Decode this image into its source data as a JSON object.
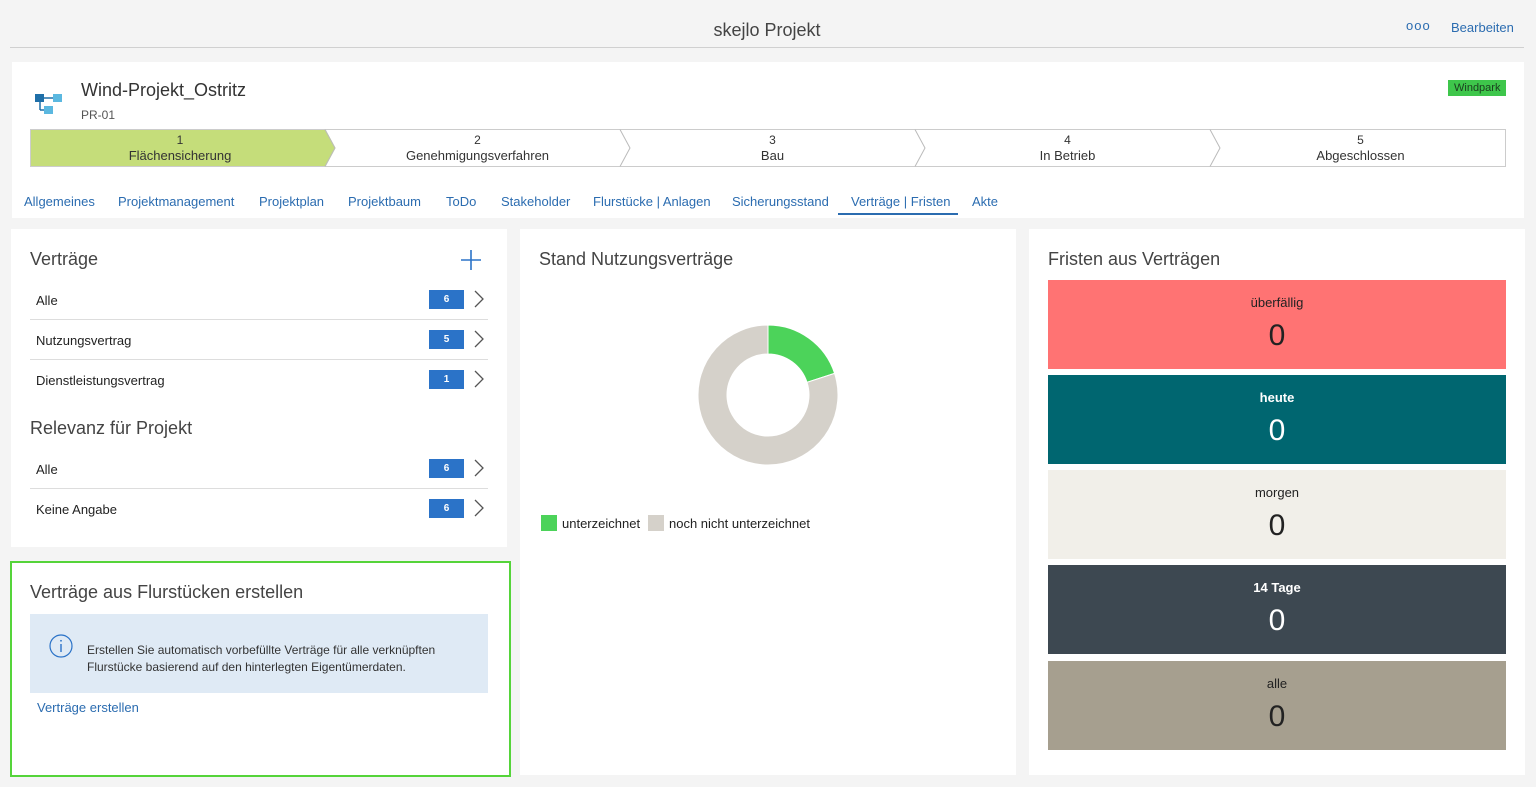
{
  "header": {
    "title": "skejlo Projekt",
    "more_label": "ooo",
    "edit_label": "Bearbeiten"
  },
  "project": {
    "name": "Wind-Projekt_Ostritz",
    "id": "PR-01",
    "badge": "Windpark",
    "badge_color": "#3ec64b"
  },
  "steps": [
    {
      "num": "1",
      "label": "Flächensicherung",
      "active": true
    },
    {
      "num": "2",
      "label": "Genehmigungsverfahren",
      "active": false
    },
    {
      "num": "3",
      "label": "Bau",
      "active": false
    },
    {
      "num": "4",
      "label": "In Betrieb",
      "active": false
    },
    {
      "num": "5",
      "label": "Abgeschlossen",
      "active": false
    }
  ],
  "tabs": [
    {
      "label": "Allgemeines"
    },
    {
      "label": "Projektmanagement"
    },
    {
      "label": "Projektplan"
    },
    {
      "label": "Projektbaum"
    },
    {
      "label": "ToDo"
    },
    {
      "label": "Stakeholder"
    },
    {
      "label": "Flurstücke | Anlagen"
    },
    {
      "label": "Sicherungsstand"
    },
    {
      "label": "Verträge | Fristen",
      "active": true
    },
    {
      "label": "Akte"
    }
  ],
  "vertraege": {
    "title": "Verträge",
    "items": [
      {
        "label": "Alle",
        "count": "6"
      },
      {
        "label": "Nutzungsvertrag",
        "count": "5"
      },
      {
        "label": "Dienstleistungsvertrag",
        "count": "1"
      }
    ],
    "relevanz_title": "Relevanz für Projekt",
    "relevanz_items": [
      {
        "label": "Alle",
        "count": "6"
      },
      {
        "label": "Keine Angabe",
        "count": "6"
      }
    ]
  },
  "flurstuecke": {
    "title": "Verträge aus Flurstücken erstellen",
    "info": "Erstellen Sie automatisch vorbefüllte Verträge für alle verknüpften Flurstücke basierend auf den hinterlegten Eigentümerdaten.",
    "link": "Verträge erstellen"
  },
  "nutzung": {
    "title": "Stand Nutzungsverträge"
  },
  "chart_data": {
    "type": "pie",
    "title": "Stand Nutzungsverträge",
    "donut": true,
    "series": [
      {
        "name": "unterzeichnet",
        "value": 1,
        "color": "#4cd35a"
      },
      {
        "name": "noch nicht unterzeichnet",
        "value": 4,
        "color": "#d5d1ca"
      }
    ],
    "legend": "bottom-left"
  },
  "fristen": {
    "title": "Fristen aus Verträgen",
    "tiles": [
      {
        "label": "überfällig",
        "value": "0",
        "bg": "#ff7373",
        "fg": "#222222",
        "bold": false
      },
      {
        "label": "heute",
        "value": "0",
        "bg": "#006670",
        "fg": "#ffffff",
        "bold": true
      },
      {
        "label": "morgen",
        "value": "0",
        "bg": "#f1efe9",
        "fg": "#222222",
        "bold": false
      },
      {
        "label": "14 Tage",
        "value": "0",
        "bg": "#3d4851",
        "fg": "#ffffff",
        "bold": true
      },
      {
        "label": "alle",
        "value": "0",
        "bg": "#a69f8f",
        "fg": "#222222",
        "bold": false
      }
    ]
  }
}
